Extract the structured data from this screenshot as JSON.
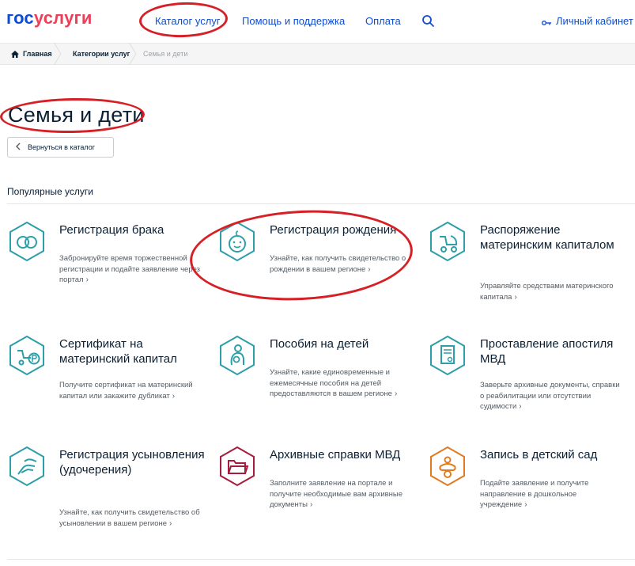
{
  "header": {
    "logo_gos": "гос",
    "logo_usl": "услуги",
    "nav_catalog": "Каталог услуг",
    "nav_help": "Помощь и поддержка",
    "nav_pay": "Оплата",
    "account": "Личный кабинет",
    "search_icon": "search-icon",
    "key_icon": "key-icon"
  },
  "breadcrumbs": {
    "home": "Главная",
    "categories": "Категории услуг",
    "current": "Семья и дети"
  },
  "page": {
    "title": "Семья и дети",
    "back_label": "Вернуться в каталог",
    "section_title": "Популярные услуги"
  },
  "cards": [
    {
      "title": "Регистрация брака",
      "desc": "Забронируйте время торжественной регистрации и подайте заявление через портал",
      "icon": "rings-icon",
      "color": "#2d9fa8"
    },
    {
      "title": "Регистрация рождения",
      "desc": "Узнайте, как получить свидетельство о рождении в вашем регионе",
      "icon": "baby-icon",
      "color": "#2d9fa8"
    },
    {
      "title": "Распоряжение материнским капиталом",
      "desc": "Управляйте средствами материнского капитала",
      "icon": "stroller-icon",
      "color": "#2d9fa8"
    },
    {
      "title": "Сертификат на материнский капитал",
      "desc": "Получите сертификат на материнский капитал или закажите дубликат",
      "icon": "stroller-ruble-icon",
      "color": "#2d9fa8"
    },
    {
      "title": "Пособия на детей",
      "desc": "Узнайте, какие единовременные и ежемесячные пособия на детей предоставляются в вашем регионе",
      "icon": "mother-child-icon",
      "color": "#2d9fa8"
    },
    {
      "title": "Проставление апостиля МВД",
      "desc": "Заверьте архивные документы, справки о реабилитации или отсутствии судимости",
      "icon": "document-seal-icon",
      "color": "#2d9fa8"
    },
    {
      "title": "Регистрация усыновления (удочерения)",
      "desc": "Узнайте, как получить свидетельство об усыновлении в вашем регионе",
      "icon": "hands-icon",
      "color": "#2d9fa8"
    },
    {
      "title": "Архивные справки МВД",
      "desc": "Заполните заявление на портале и получите необходимые вам архивные документы",
      "icon": "folder-icon",
      "color": "#a51d3c"
    },
    {
      "title": "Запись в детский сад",
      "desc": "Подайте заявление и получите направление в дошкольное учреждение",
      "icon": "pacifier-icon",
      "color": "#e07b1f"
    }
  ],
  "colors": {
    "link_blue": "#0d4cd3",
    "teal": "#2d9fa8",
    "burgundy": "#a51d3c",
    "orange": "#e07b1f",
    "annotation_red": "#d71f26"
  }
}
